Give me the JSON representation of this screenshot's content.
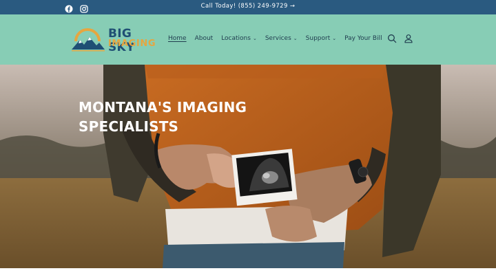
{
  "announcement": {
    "text": "Call Today! (855) 249-9729",
    "arrow": "→",
    "social_icons": [
      "facebook-icon",
      "instagram-icon"
    ]
  },
  "brand": {
    "line1": "BIG SKY",
    "line2": "IMAGING",
    "colors": {
      "navy": "#1f4f74",
      "gold": "#e6a640"
    }
  },
  "nav": {
    "items": [
      {
        "label": "Home",
        "active": true,
        "dropdown": false
      },
      {
        "label": "About",
        "active": false,
        "dropdown": false
      },
      {
        "label": "Locations",
        "active": false,
        "dropdown": true
      },
      {
        "label": "Services",
        "active": false,
        "dropdown": true
      },
      {
        "label": "Support",
        "active": false,
        "dropdown": true
      },
      {
        "label": "Pay Your Bill",
        "active": false,
        "dropdown": false
      }
    ],
    "chevron": "⌄"
  },
  "header_icons": [
    "search-icon",
    "account-icon"
  ],
  "hero": {
    "title_line1": "MONTANA'S IMAGING",
    "title_line2": "SPECIALISTS"
  },
  "colors": {
    "topbar": "#2a5a80",
    "header": "#87cdb5",
    "text": "#1f3c4e"
  }
}
